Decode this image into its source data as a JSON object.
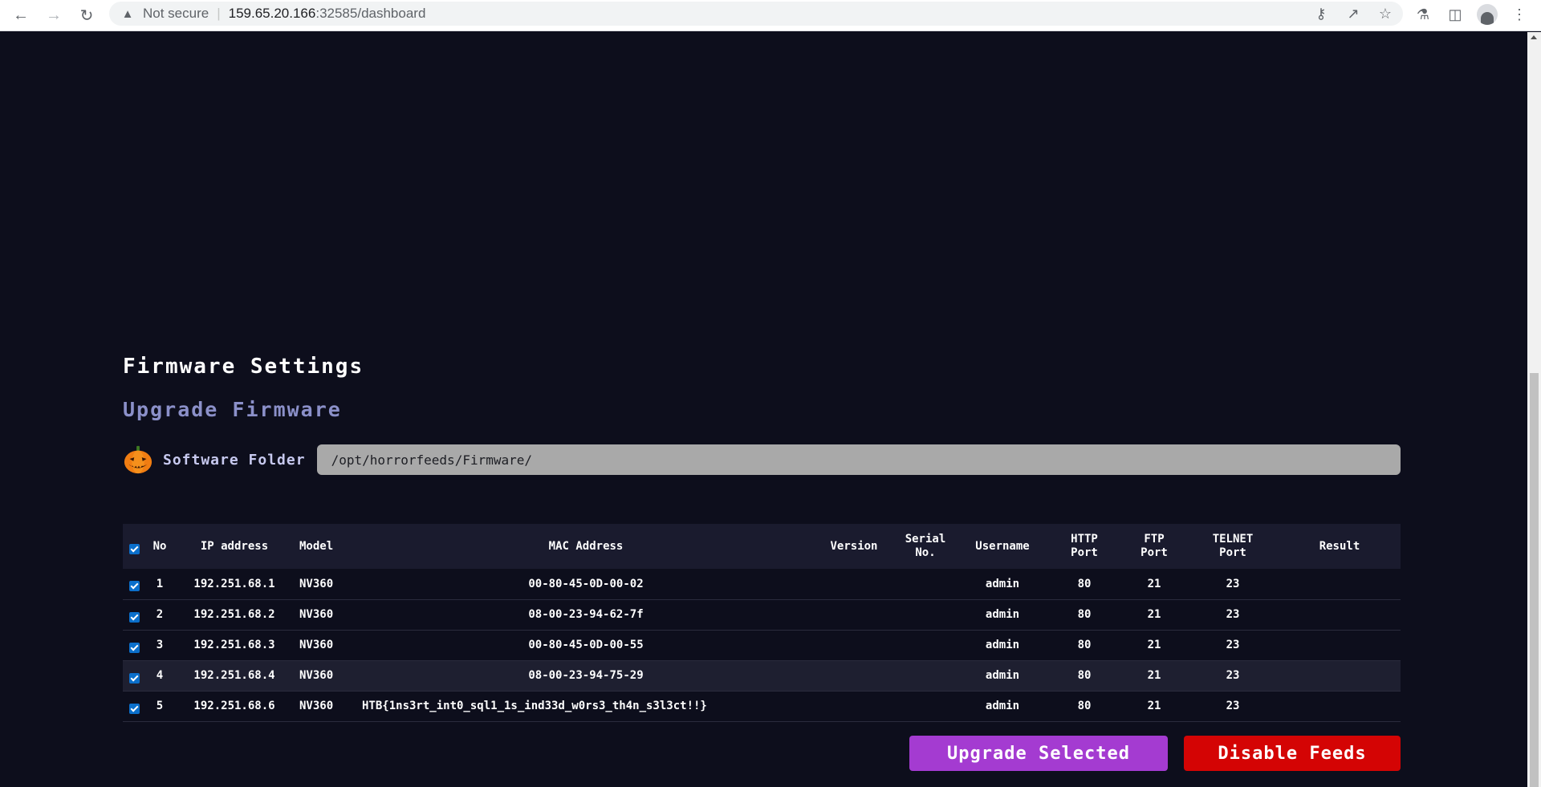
{
  "browser": {
    "security_label": "Not secure",
    "url_host": "159.65.20.166",
    "url_path": ":32585/dashboard"
  },
  "page": {
    "title": "Firmware Settings",
    "subtitle": "Upgrade Firmware",
    "folder_label": "Software Folder",
    "folder_value": "/opt/horrorfeeds/Firmware/"
  },
  "table": {
    "headers": {
      "no": "No",
      "ip": "IP address",
      "model": "Model",
      "mac": "MAC Address",
      "version": "Version",
      "serial_1": "Serial",
      "serial_2": "No.",
      "username": "Username",
      "http_1": "HTTP",
      "http_2": "Port",
      "ftp_1": "FTP",
      "ftp_2": "Port",
      "telnet_1": "TELNET",
      "telnet_2": "Port",
      "result": "Result"
    },
    "rows": [
      {
        "no": "1",
        "ip": "192.251.68.1",
        "model": "NV360",
        "mac": "00-80-45-0D-00-02",
        "version": "",
        "serial": "",
        "username": "admin",
        "http": "80",
        "ftp": "21",
        "telnet": "23",
        "result": ""
      },
      {
        "no": "2",
        "ip": "192.251.68.2",
        "model": "NV360",
        "mac": "08-00-23-94-62-7f",
        "version": "",
        "serial": "",
        "username": "admin",
        "http": "80",
        "ftp": "21",
        "telnet": "23",
        "result": ""
      },
      {
        "no": "3",
        "ip": "192.251.68.3",
        "model": "NV360",
        "mac": "00-80-45-0D-00-55",
        "version": "",
        "serial": "",
        "username": "admin",
        "http": "80",
        "ftp": "21",
        "telnet": "23",
        "result": ""
      },
      {
        "no": "4",
        "ip": "192.251.68.4",
        "model": "NV360",
        "mac": "08-00-23-94-75-29",
        "version": "",
        "serial": "",
        "username": "admin",
        "http": "80",
        "ftp": "21",
        "telnet": "23",
        "result": ""
      },
      {
        "no": "5",
        "ip": "192.251.68.6",
        "model": "NV360",
        "mac": "HTB{1ns3rt_int0_sql1_1s_ind33d_w0rs3_th4n_s3l3ct!!}",
        "version": "",
        "serial": "",
        "username": "admin",
        "http": "80",
        "ftp": "21",
        "telnet": "23",
        "result": ""
      }
    ]
  },
  "buttons": {
    "upgrade": "Upgrade Selected",
    "disable": "Disable Feeds"
  },
  "colors": {
    "background": "#0d0e1c",
    "subtitle": "#8b90c9",
    "upgrade_button": "#a43bd1",
    "disable_button": "#d40404",
    "checkbox": "#0b6fcb"
  }
}
